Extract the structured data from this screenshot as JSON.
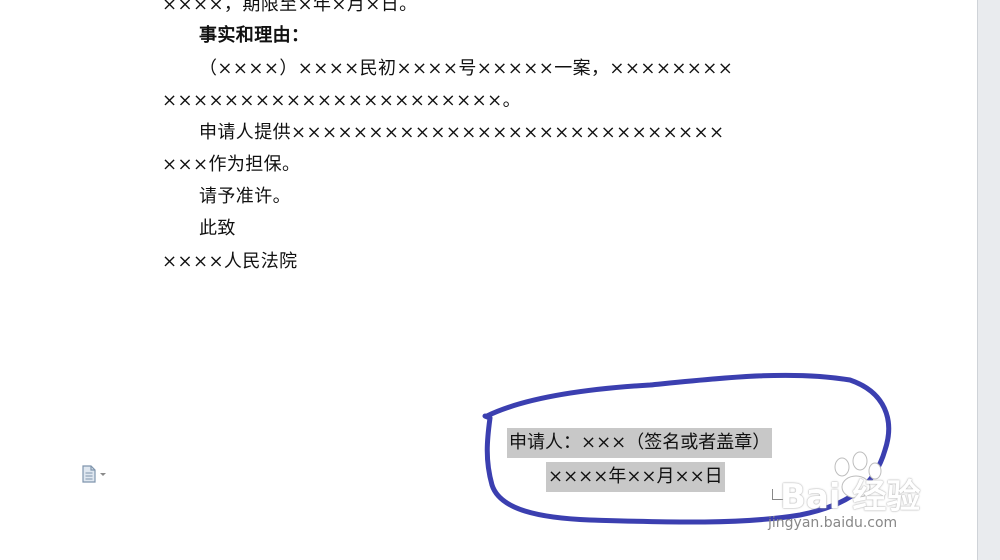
{
  "document": {
    "lines": [
      {
        "text": "××××，期限至×年×月×日。"
      },
      {
        "text": "事实和理由：",
        "bold": true
      },
      {
        "text": "（××××）××××民初××××号×××××一案，××××××××"
      },
      {
        "text": "××××××××××××××××××××××。"
      },
      {
        "text": "申请人提供××××××××××××××××××××××××××××"
      },
      {
        "text": "×××作为担保。"
      },
      {
        "text": "请予准许。"
      },
      {
        "text": "此致"
      },
      {
        "text": "××××人民法院"
      }
    ],
    "signature": {
      "applicant": "申请人：×××（签名或者盖章）",
      "date": "××××年××月××日"
    }
  },
  "watermark": {
    "main": "Bai 经验",
    "url": "jingyan.baidu.com"
  },
  "icons": {
    "doc": "document-options-icon",
    "paragraph": "paragraph-mark-icon"
  },
  "colors": {
    "highlight": "#c8c8c8",
    "pen": "#3b3fb0",
    "gutter": "#e9ebee"
  }
}
